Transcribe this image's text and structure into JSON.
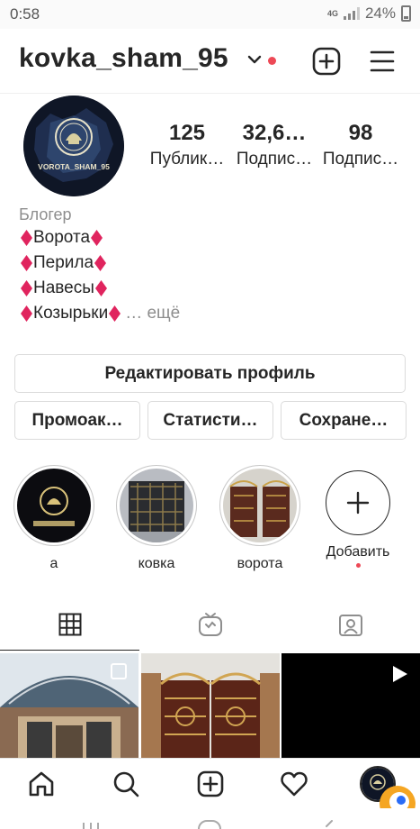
{
  "status_bar": {
    "time": "0:58",
    "network": "4G",
    "battery": "24%"
  },
  "header": {
    "username": "kovka_sham_95"
  },
  "profile": {
    "stats": [
      {
        "value": "125",
        "label": "Публик…"
      },
      {
        "value": "32,6…",
        "label": "Подпис…"
      },
      {
        "value": "98",
        "label": "Подпис…"
      }
    ],
    "avatar_text": "VOROTA_SHAM_95",
    "category": "Блогер",
    "bio_lines": [
      "Ворота",
      "Перила",
      "Навесы",
      "Козырьки"
    ],
    "more_label": "… ещё"
  },
  "buttons": {
    "edit_profile": "Редактировать профиль",
    "promo": "Промоак…",
    "stats": "Статисти…",
    "saved": "Сохране…"
  },
  "highlights": [
    {
      "label": "а"
    },
    {
      "label": "ковка"
    },
    {
      "label": "ворота"
    }
  ],
  "add_highlight_label": "Добавить",
  "colors": {
    "accent_red": "#ed4956",
    "text": "#262626",
    "muted": "#8e8e8e",
    "border": "#dbdbdb"
  },
  "icons": [
    "chevron-down-icon",
    "new-post-icon",
    "menu-icon",
    "grid-icon",
    "igtv-icon",
    "tagged-icon",
    "home-icon",
    "search-icon",
    "add-icon",
    "heart-icon",
    "play-icon"
  ]
}
